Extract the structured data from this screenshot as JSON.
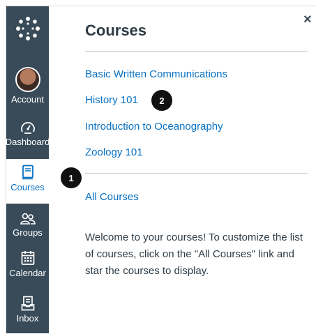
{
  "sidebar": {
    "logo": "canvas-logo-icon",
    "items": [
      {
        "label": "Account",
        "icon": "avatar"
      },
      {
        "label": "Dashboard",
        "icon": "dashboard-gauge-icon"
      },
      {
        "label": "Courses",
        "icon": "book-icon",
        "active": true
      },
      {
        "label": "Groups",
        "icon": "groups-icon"
      },
      {
        "label": "Calendar",
        "icon": "calendar-icon"
      },
      {
        "label": "Inbox",
        "icon": "inbox-icon"
      }
    ]
  },
  "tray": {
    "title": "Courses",
    "close_symbol": "×",
    "courses": [
      "Basic Written Communications",
      "History 101",
      "Introduction to Oceanography",
      "Zoology 101"
    ],
    "all_courses": "All Courses",
    "welcome_text": "Welcome to your courses! To customize the list of courses, click on the \"All Courses\" link and star the courses to display."
  },
  "callouts": [
    "1",
    "2"
  ],
  "colors": {
    "sidebar_bg": "#394b58",
    "link": "#0770c2",
    "text": "#2d3b45",
    "callout": "#111111"
  }
}
